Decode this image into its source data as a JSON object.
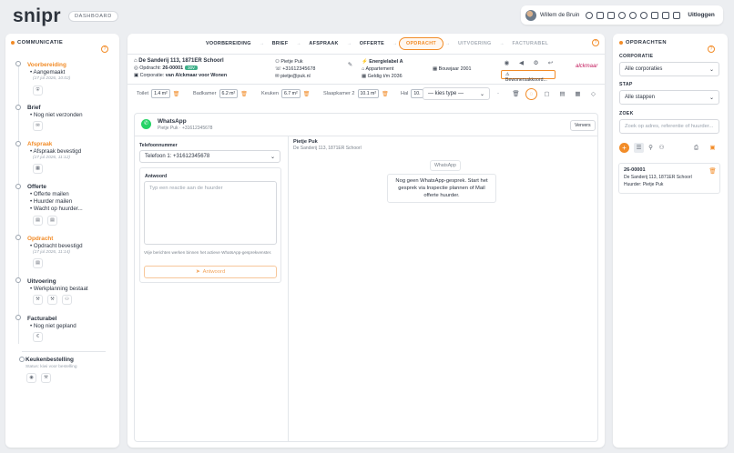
{
  "brand": {
    "logo": "snipr",
    "dashboard": "DASHBOARD"
  },
  "topbar": {
    "user": "Willem de Bruin",
    "logout": "Uitloggen"
  },
  "left": {
    "title": "COMMUNICATIE",
    "steps": [
      {
        "title": "Voorbereiding",
        "items": [
          "Aangemaakt"
        ],
        "date": "(17 jul 2026, 10:02)"
      },
      {
        "title": "Brief",
        "items": [
          "Nog niet verzonden"
        ]
      },
      {
        "title": "Afspraak",
        "items": [
          "Afspraak bevestigd"
        ],
        "date": "(17 jul 2026, 11:12)"
      },
      {
        "title": "Offerte",
        "items": [
          "Offerte mailen",
          "Huurder mailen",
          "Wacht op huurder..."
        ]
      },
      {
        "title": "Opdracht",
        "items": [
          "Opdracht bevestigd"
        ],
        "date": "(17 jul 2026, 11:14)"
      },
      {
        "title": "Uitvoering",
        "items": [
          "Werkplanning bestaat"
        ]
      },
      {
        "title": "Facturabel",
        "items": [
          "Nog niet gepland"
        ]
      },
      {
        "title": "Keukenbestelling",
        "items": [
          "Status: kiwi voor bestelling"
        ]
      }
    ]
  },
  "stepper": [
    "VOORBEREIDING",
    "BRIEF",
    "AFSPRAAK",
    "OFFERTE",
    "OPDRACHT",
    "UITVOERING",
    "FACTURABEL"
  ],
  "address": {
    "line": "De Sanderij 113, 1871ER Schoorl",
    "opdracht_label": "Opdracht:",
    "opdracht": "26-00001",
    "badge": "30V",
    "corporatie_label": "Corporatie:",
    "corporatie": "van Alckmaar voor Wonen"
  },
  "tenant": {
    "name": "Pietje Puk",
    "phone": "+31612345678",
    "email": "pietje@puk.nl"
  },
  "house": {
    "energy": "Energielabel A",
    "type": "Appartement",
    "valid": "Geldig t/m 2036",
    "built": "Bouwjaar 2001"
  },
  "approval": "Bewonersakkoord...",
  "brand_logo": "alckmaar",
  "measures": [
    {
      "label": "Toilet",
      "value": "1.4 m²"
    },
    {
      "label": "Badkamer",
      "value": "6.2 m²"
    },
    {
      "label": "Keuken",
      "value": "6.7 m²"
    },
    {
      "label": "Slaapkamer 2",
      "value": "10.1 m²"
    },
    {
      "label": "Hal",
      "value": "10."
    }
  ],
  "type_select": "— kies type —",
  "whatsapp": {
    "title": "WhatsApp",
    "sub": "Pietje Puk · +31612345678",
    "refresh": "Ververs",
    "phone_label": "Telefoonnummer",
    "phone_value": "Telefoon 1: +31612345678",
    "answer_label": "Antwoord",
    "answer_placeholder": "Typ een reactie aan de huurder",
    "note": "Vrije berichten werken binnen het actieve WhatsApp-gesprekvenster.",
    "send": "Antwoord",
    "chat_name": "Pietje Puk",
    "chat_address": "De Sanderij 113, 1871ER Schoorl",
    "chip": "WhatsApp",
    "empty": "Nog geen WhatsApp-gesprek. Start het gesprek via Inspectie plannen of Mail offerte huurder."
  },
  "right": {
    "title": "OPDRACHTEN",
    "corporatie_label": "CORPORATIE",
    "corporatie_value": "Alle corporaties",
    "stap_label": "STAP",
    "stap_value": "Alle stappen",
    "zoek_label": "ZOEK",
    "zoek_placeholder": "Zoek op adres, referentie of huurder...",
    "result": {
      "id": "26-00001",
      "address": "De Sanderij 113, 1871ER Schoorl",
      "tenant": "Huurder: Pietje Puk"
    }
  },
  "colors": {
    "accent": "#f28c28",
    "whatsapp": "#25d366",
    "badge": "#3fb08a"
  }
}
